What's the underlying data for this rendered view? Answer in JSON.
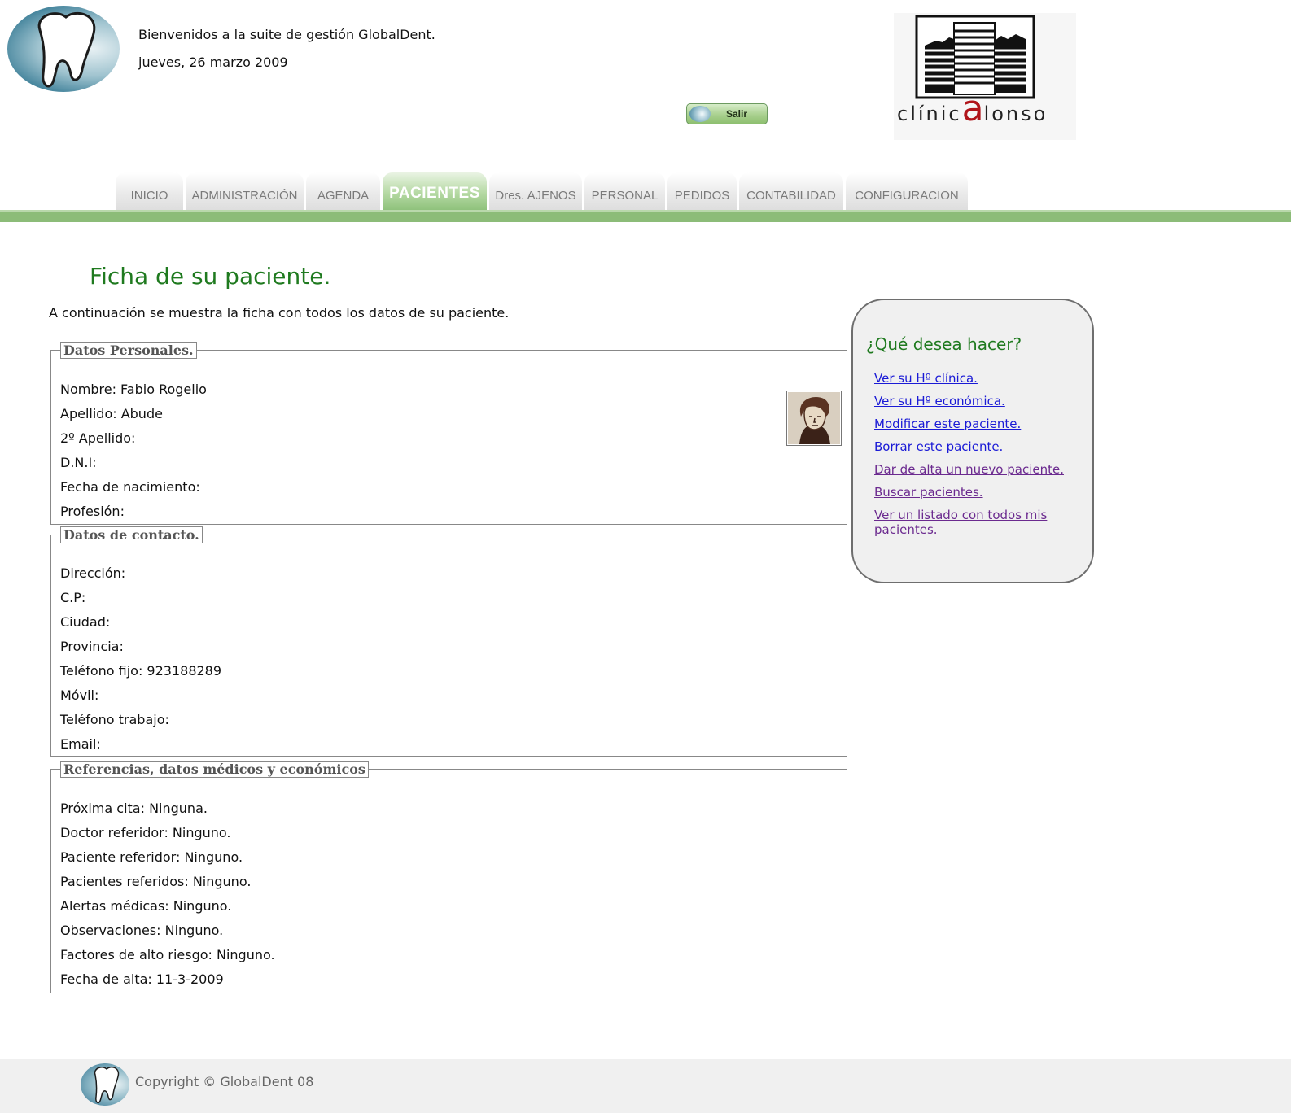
{
  "header": {
    "welcome": "Bienvenidos a la suite de gestión GlobalDent.",
    "date": "jueves, 26 marzo 2009",
    "logout_label": "Salir",
    "clinic_brand_prefix": "clínic",
    "clinic_brand_big": "a",
    "clinic_brand_suffix": "lonso"
  },
  "nav": {
    "tabs": [
      {
        "label": "INICIO"
      },
      {
        "label": "ADMINISTRACIÓN"
      },
      {
        "label": "AGENDA"
      },
      {
        "label": "PACIENTES"
      },
      {
        "label": "Dres. AJENOS"
      },
      {
        "label": "PERSONAL"
      },
      {
        "label": "PEDIDOS"
      },
      {
        "label": "CONTABILIDAD"
      },
      {
        "label": "CONFIGURACION"
      }
    ],
    "active_tab": "PACIENTES"
  },
  "main": {
    "title": "Ficha de su paciente.",
    "intro": "A continuación se muestra la ficha con todos los datos de su paciente.",
    "personal": {
      "legend": "Datos Personales.",
      "fields": [
        "Nombre: Fabio Rogelio",
        "Apellido: Abude",
        "2º Apellido:",
        "D.N.I:",
        "Fecha de nacimiento:",
        "Profesión:"
      ]
    },
    "contact": {
      "legend": "Datos de contacto.",
      "fields": [
        "Dirección:",
        "C.P:",
        "Ciudad:",
        "Provincia:",
        "Teléfono fijo: 923188289",
        "Móvil:",
        "Teléfono trabajo:",
        "Email:"
      ]
    },
    "references": {
      "legend": "Referencias, datos médicos y económicos",
      "fields": [
        "Próxima cita: Ninguna.",
        "Doctor referidor: Ninguno.",
        "Paciente referidor: Ninguno.",
        "Pacientes referidos: Ninguno.",
        "Alertas médicas: Ninguno.",
        "Observaciones: Ninguno.",
        "Factores de alto riesgo: Ninguno.",
        "Fecha de alta: 11-3-2009"
      ]
    }
  },
  "actions": {
    "title": "¿Qué desea hacer?",
    "links": [
      {
        "label": "Ver su Hº clínica.",
        "visited": false
      },
      {
        "label": "Ver su Hº económica.",
        "visited": false
      },
      {
        "label": "Modificar este paciente.",
        "visited": false
      },
      {
        "label": "Borrar este paciente.",
        "visited": false
      },
      {
        "label": "Dar de alta un nuevo paciente.",
        "visited": true
      },
      {
        "label": "Buscar pacientes.",
        "visited": true
      },
      {
        "label": "Ver un listado con todos mis pacientes.",
        "visited": true
      }
    ]
  },
  "footer": {
    "copyright": "Copyright © GlobalDent 08"
  },
  "icons": {
    "app_logo": "tooth-logo-icon",
    "logout": "tooth-icon",
    "patient_photo": "patient-photo"
  },
  "colors": {
    "accent_green": "#1f7a1f",
    "nav_bar_green": "#8cbc78",
    "link": "#1a1ad6",
    "link_visited": "#6b2a8f",
    "brand_red": "#b0141a"
  }
}
